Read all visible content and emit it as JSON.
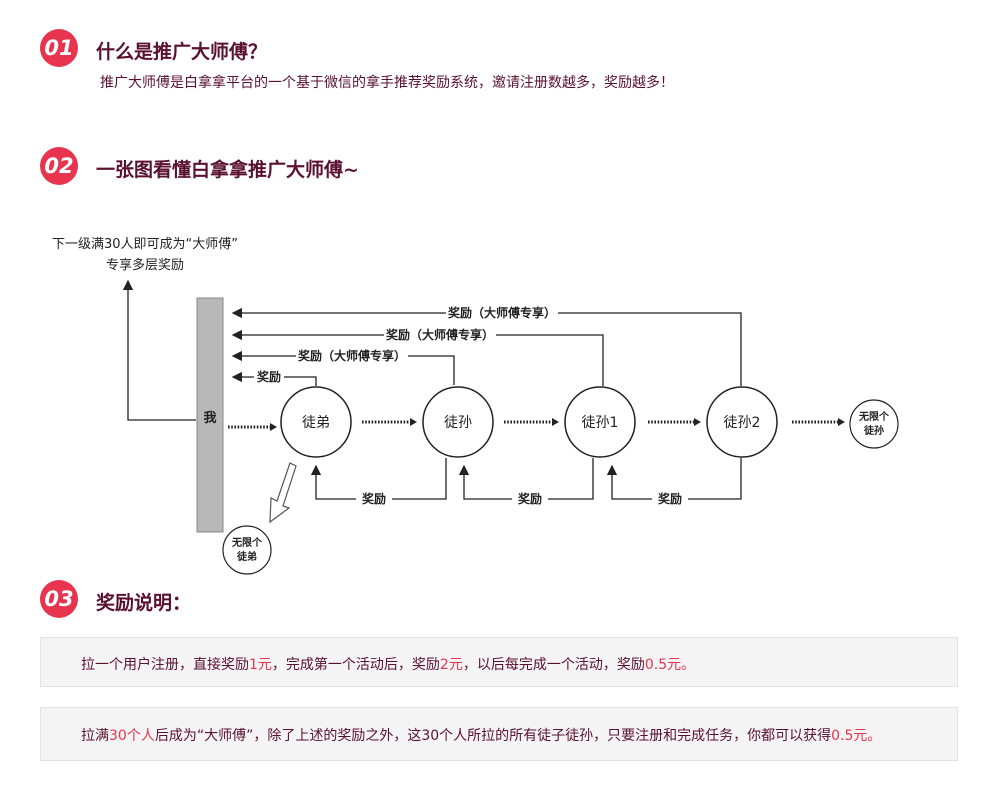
{
  "sections": [
    {
      "number": "01",
      "title": "什么是推广大师傅？",
      "desc": "推广大师傅是白拿拿平台的一个基于微信的拿手推荐奖励系统，邀请注册数越多，奖励越多！"
    },
    {
      "number": "02",
      "title": "一张图看懂白拿拿推广大师傅~"
    },
    {
      "number": "03",
      "title": "奖励说明："
    }
  ],
  "diagram": {
    "top_note_line1": "下一级满30人即可成为“大师傅”",
    "top_note_line2": "专享多层奖励",
    "me_label": "我",
    "nodes": [
      "徒弟",
      "徒孙",
      "徒孙1",
      "徒孙2"
    ],
    "unlimited_right_line1": "无限个",
    "unlimited_right_line2": "徒孙",
    "unlimited_left_line1": "无限个",
    "unlimited_left_line2": "徒弟",
    "reward_basic": "奖励",
    "reward_master": "奖励（大师傅专享）",
    "bottom_reward": "奖励"
  },
  "rewards": {
    "item1": {
      "p1": "拉一个用户注册，直接奖励",
      "v1": "1元",
      "p2": "，完成第一个活动后，奖励",
      "v2": "2元",
      "p3": "，以后每完成一个活动，奖励",
      "v3": "0.5元。"
    },
    "item2": {
      "p1": "拉满",
      "v1": "30个人",
      "p2": "后成为“大师傅”，除了上述的奖励之外，这30个人所拉的所有徒子徒孙，只要注册和完成任务，你都可以获得",
      "v2": "0.5元。"
    }
  }
}
